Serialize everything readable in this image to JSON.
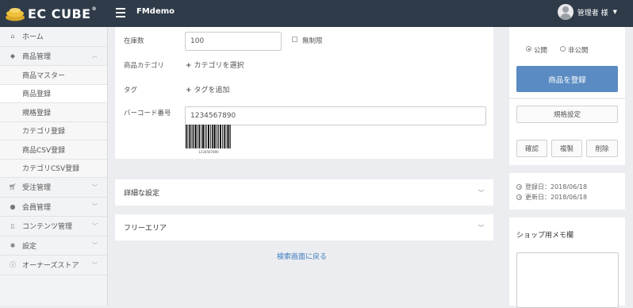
{
  "header": {
    "logo_text": "EC CUBE",
    "logo_mark": "®",
    "shop_name": "FMdemo",
    "user_name": "管理者 様",
    "icons": [
      "hamburger-icon",
      "avatar",
      "chevron-down-icon"
    ]
  },
  "sidebar": {
    "items": [
      {
        "label": "ホーム",
        "icon": "home-icon"
      },
      {
        "label": "商品管理",
        "icon": "tag-icon"
      },
      {
        "label": "受注管理",
        "icon": "cart-icon"
      },
      {
        "label": "会員管理",
        "icon": "users-icon"
      },
      {
        "label": "コンテンツ管理",
        "icon": "file-icon"
      },
      {
        "label": "設定",
        "icon": "gear-icon"
      },
      {
        "label": "オーナーズストア",
        "icon": "info-icon"
      }
    ],
    "subitems": [
      "商品マスター",
      "商品登録",
      "規格登録",
      "カテゴリ登録",
      "商品CSV登録",
      "カテゴリCSV登録"
    ],
    "active_subitem": "商品登録"
  },
  "form": {
    "stock_label": "在庫数",
    "stock_value": "100",
    "unlimited_label": "無制限",
    "category_label": "商品カテゴリ",
    "category_link": "カテゴリを選択",
    "tag_label": "タグ",
    "tag_link": "タグを追加",
    "barcode_label": "バーコード番号",
    "barcode_value": "1234567890",
    "barcode_caption": "1234567890"
  },
  "sections": {
    "detail_title": "詳細な設定",
    "free_area_title": "フリーエリア",
    "back_link": "検索画面に戻る"
  },
  "right": {
    "public_label": "公開",
    "private_label": "非公開",
    "publish_state": "公開",
    "register_button": "商品を登録",
    "spec_button": "規格設定",
    "copy_button": "複製",
    "preview_button": "確認",
    "delete_button": "削除",
    "registered_date": "登録日：2018/06/18",
    "updated_date": "更新日：2018/06/18",
    "memo_title": "ショップ用メモ欄",
    "memo_value": ""
  },
  "colors": {
    "header_bg": "#2f3b49",
    "primary_button": "#5b8bc3",
    "link": "#3b7bbf",
    "page_bg": "#ecedf0"
  }
}
